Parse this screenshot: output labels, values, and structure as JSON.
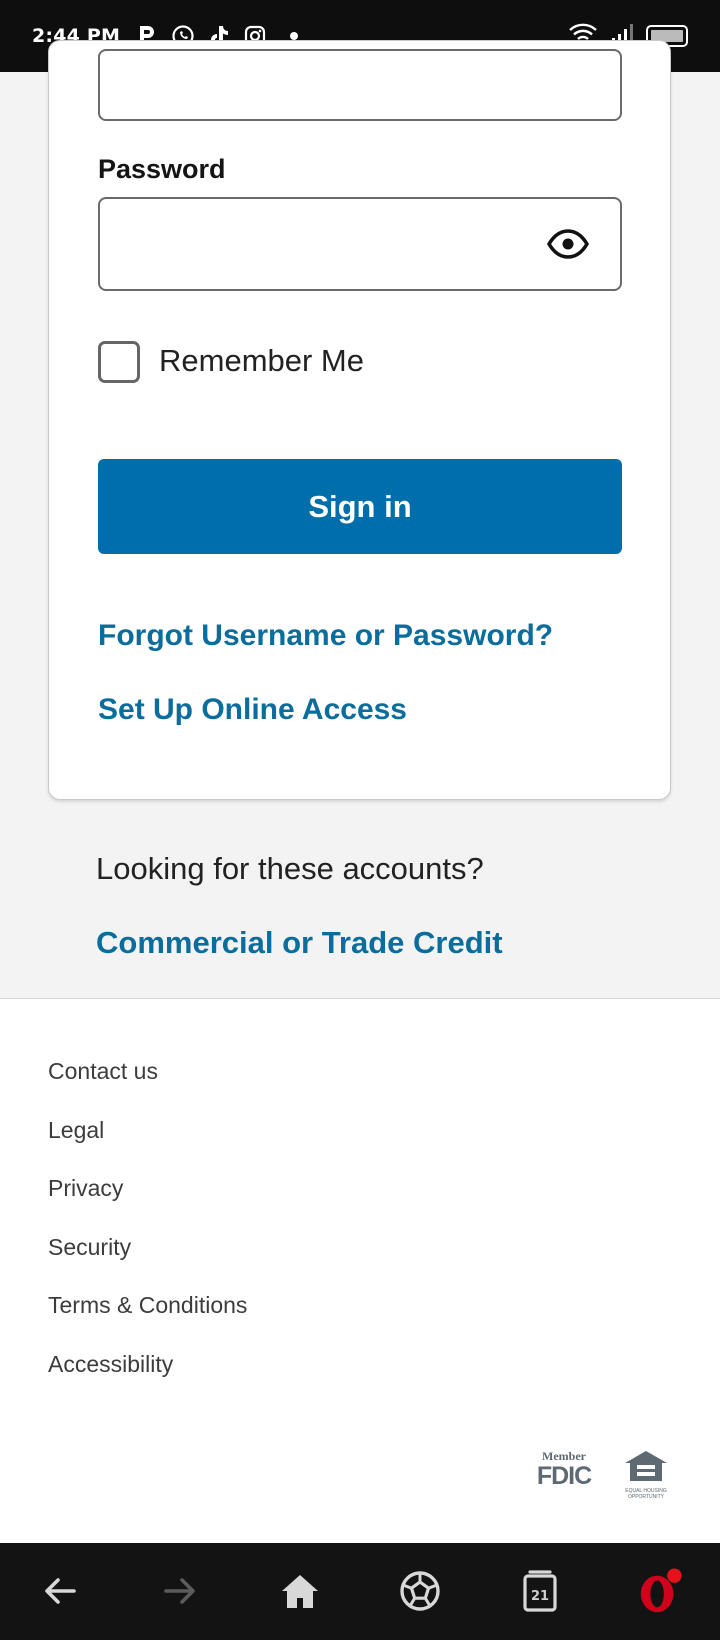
{
  "status_bar": {
    "time": "2:44 PM",
    "app_icons": [
      "p-icon",
      "whatsapp-icon",
      "tiktok-icon",
      "instagram-icon"
    ],
    "right_icons": [
      "wifi-icon",
      "signal-icon",
      "battery-icon"
    ]
  },
  "login": {
    "username_value": "",
    "password_label": "Password",
    "password_value": "",
    "remember_label": "Remember Me",
    "remember_checked": false,
    "signin_label": "Sign in",
    "forgot_link": "Forgot Username or Password?",
    "setup_link": "Set Up Online Access"
  },
  "accounts": {
    "looking_text": "Looking for these accounts?",
    "commercial_link": "Commercial or Trade Credit"
  },
  "footer": {
    "links": [
      "Contact us",
      "Legal",
      "Privacy",
      "Security",
      "Terms & Conditions",
      "Accessibility"
    ],
    "fdic_member": "Member",
    "fdic_word": "FDIC",
    "equal_housing": "EQUAL HOUSING OPPORTUNITY"
  },
  "browser_bar": {
    "tab_count": "21"
  },
  "colors": {
    "accent": "#006eab",
    "link": "#0b6d9c",
    "status_bar_bg": "#0e0e0e",
    "page_bg": "#f3f3f3",
    "opera_red": "#d0021b"
  }
}
